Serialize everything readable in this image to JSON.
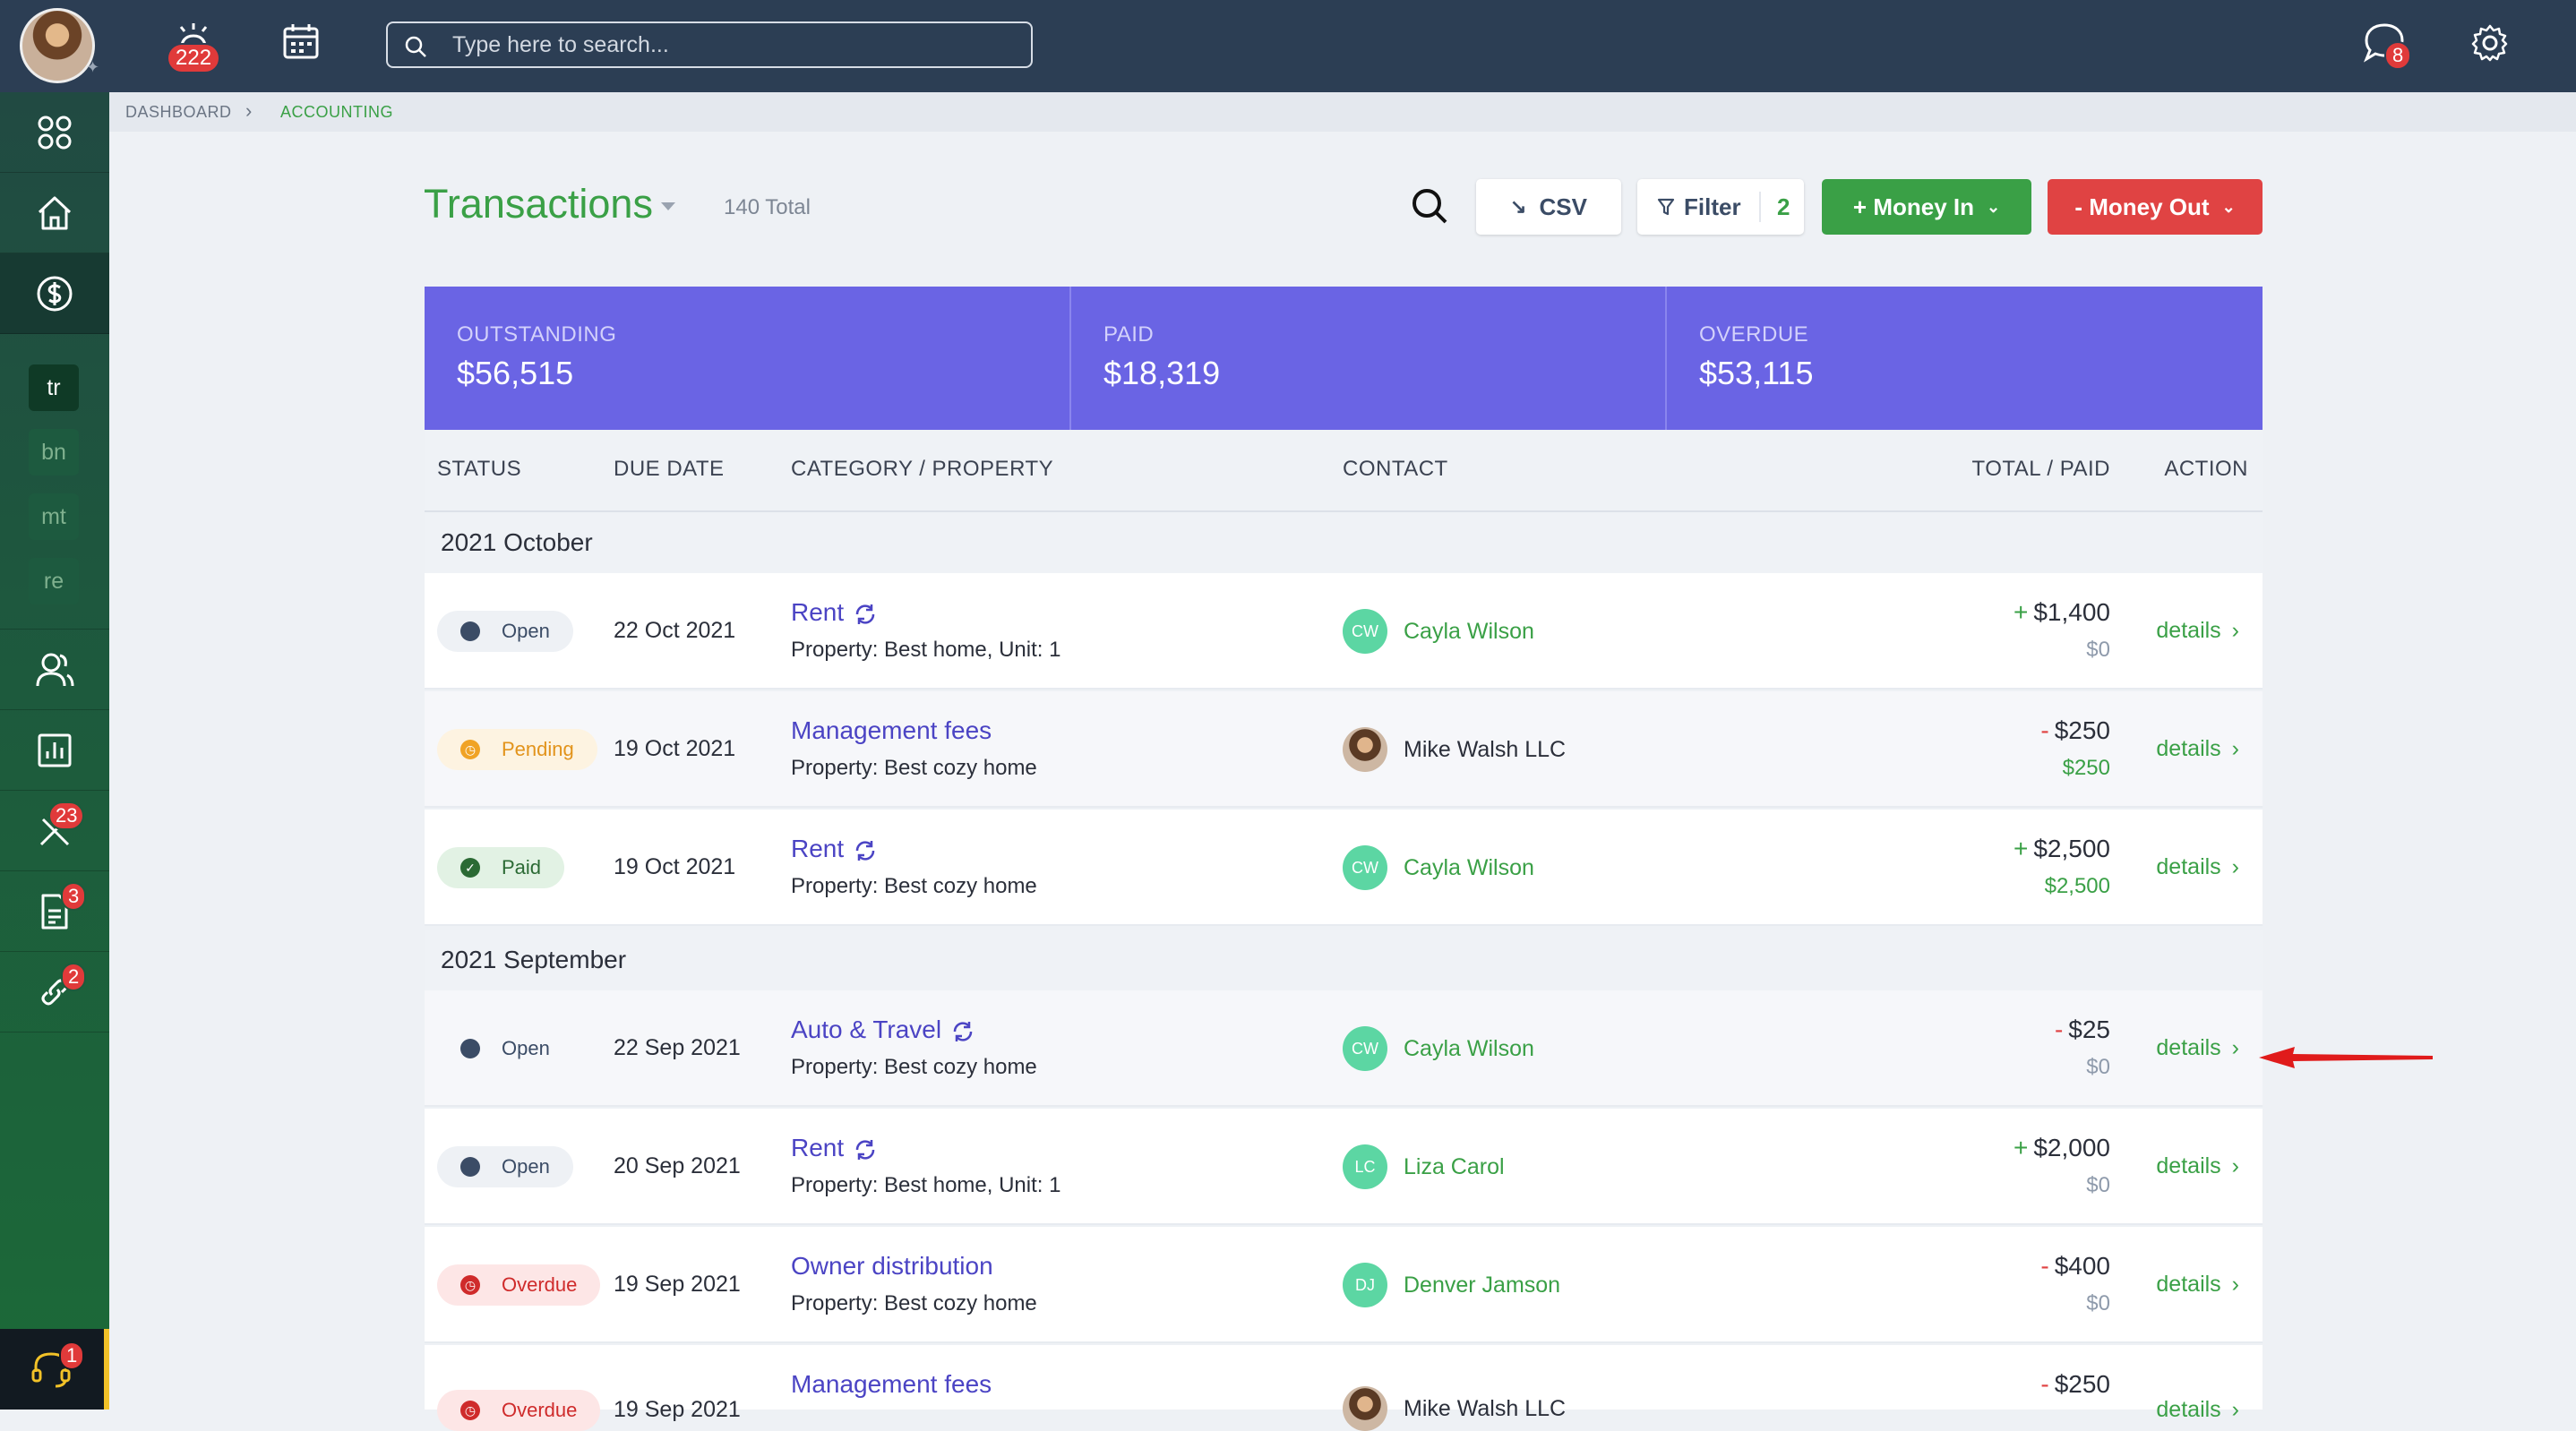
{
  "topbar": {
    "notifications_count": "222",
    "search": {
      "placeholder": "Type here to search..."
    },
    "messages_count": "8"
  },
  "sidebar": {
    "items": [
      {
        "icon": "grid-icon"
      },
      {
        "icon": "home-icon"
      },
      {
        "icon": "dollar-icon",
        "active": true
      },
      {
        "chip": "tr"
      },
      {
        "chip": "bn"
      },
      {
        "chip": "mt"
      },
      {
        "chip": "re"
      },
      {
        "icon": "users-icon"
      },
      {
        "icon": "chart-icon"
      },
      {
        "icon": "tools-icon",
        "badge": "23"
      },
      {
        "icon": "document-icon",
        "badge": "3"
      },
      {
        "icon": "link-icon",
        "badge": "2"
      }
    ],
    "support_badge": "1"
  },
  "breadcrumb": {
    "items": [
      "DASHBOARD",
      "ACCOUNTING"
    ]
  },
  "page": {
    "title": "Transactions",
    "total": "140 Total",
    "buttons": {
      "csv": "CSV",
      "filter": "Filter",
      "filter_count": "2",
      "money_in": "+ Money In",
      "money_out": "- Money Out"
    }
  },
  "summary": [
    {
      "label": "OUTSTANDING",
      "value": "$56,515"
    },
    {
      "label": "PAID",
      "value": "$18,319"
    },
    {
      "label": "OVERDUE",
      "value": "$53,115"
    }
  ],
  "table": {
    "headers": [
      "STATUS",
      "DUE DATE",
      "CATEGORY / PROPERTY",
      "CONTACT",
      "TOTAL / PAID",
      "ACTION"
    ],
    "groups": [
      "2021 October",
      "2021 September"
    ],
    "rows": [
      {
        "status": "Open",
        "due": "22 Oct 2021",
        "category": "Rent",
        "property": "Property: Best home, Unit: 1",
        "contact_initials": "CW",
        "contact": "Cayla Wilson",
        "sign": "+",
        "total": "$1,400",
        "paid": "$0",
        "action": "details"
      },
      {
        "status": "Pending",
        "due": "19 Oct 2021",
        "category": "Management fees",
        "property": "Property: Best cozy home",
        "contact_initials": "",
        "contact": "Mike Walsh LLC",
        "sign": "-",
        "total": "$250",
        "paid": "$250",
        "action": "details"
      },
      {
        "status": "Paid",
        "due": "19 Oct 2021",
        "category": "Rent",
        "property": "Property: Best cozy home",
        "contact_initials": "CW",
        "contact": "Cayla Wilson",
        "sign": "+",
        "total": "$2,500",
        "paid": "$2,500",
        "action": "details"
      },
      {
        "status": "Open",
        "due": "22 Sep 2021",
        "category": "Auto & Travel",
        "property": "Property: Best cozy home",
        "contact_initials": "CW",
        "contact": "Cayla Wilson",
        "sign": "-",
        "total": "$25",
        "paid": "$0",
        "action": "details"
      },
      {
        "status": "Open",
        "due": "20 Sep 2021",
        "category": "Rent",
        "property": "Property: Best home, Unit: 1",
        "contact_initials": "LC",
        "contact": "Liza Carol",
        "sign": "+",
        "total": "$2,000",
        "paid": "$0",
        "action": "details"
      },
      {
        "status": "Overdue",
        "due": "19 Sep 2021",
        "category": "Owner distribution",
        "property": "Property: Best cozy home",
        "contact_initials": "DJ",
        "contact": "Denver Jamson",
        "sign": "-",
        "total": "$400",
        "paid": "$0",
        "action": "details"
      },
      {
        "status": "Overdue",
        "due": "19 Sep 2021",
        "category": "Management fees",
        "property": "",
        "contact_initials": "",
        "contact": "Mike Walsh LLC",
        "sign": "-",
        "total": "$250",
        "paid": "",
        "action": "details"
      }
    ]
  },
  "colors": {
    "accent_green": "#3aa046",
    "summary_purple": "#6a64e4",
    "money_out_red": "#e04343",
    "topbar": "#2c3e54"
  }
}
